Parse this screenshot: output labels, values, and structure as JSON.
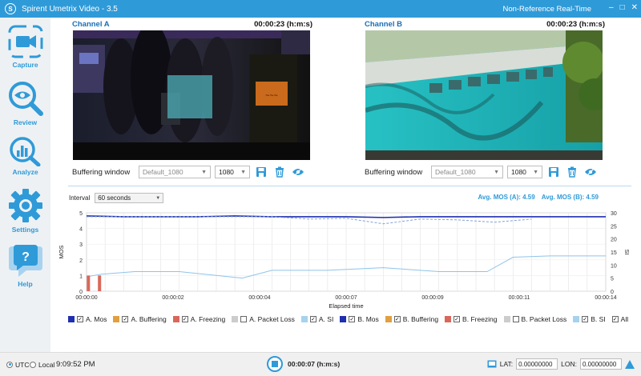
{
  "window": {
    "title": "Spirent Umetrix Video - 3.5",
    "mode": "Non-Reference Real-Time",
    "minimize": "–",
    "maximize": "□",
    "close": "✕"
  },
  "sidebar": {
    "items": [
      {
        "label": "Capture",
        "icon": "camera-icon"
      },
      {
        "label": "Review",
        "icon": "magnifier-icon"
      },
      {
        "label": "Analyze",
        "icon": "analyze-icon"
      },
      {
        "label": "Settings",
        "icon": "gear-icon"
      },
      {
        "label": "Help",
        "icon": "help-icon"
      }
    ]
  },
  "channels": [
    {
      "name": "Channel A",
      "time": "00:00:23 (h:m:s)",
      "buffering_label": "Buffering window",
      "buffering_placeholder": "Default_1080",
      "resolution": "1080"
    },
    {
      "name": "Channel B",
      "time": "00:00:23 (h:m:s)",
      "buffering_label": "Buffering window",
      "buffering_placeholder": "Default_1080",
      "resolution": "1080"
    }
  ],
  "interval": {
    "label": "Interval",
    "value": "60 seconds"
  },
  "averages": {
    "a": "Avg. MOS (A): 4.59",
    "b": "Avg. MOS (B): 4.59"
  },
  "legend": [
    {
      "label": "A. Mos",
      "color": "#1f2fb0",
      "checked": true
    },
    {
      "label": "A. Buffering",
      "color": "#e0a040",
      "checked": true
    },
    {
      "label": "A. Freezing",
      "color": "#d9685a",
      "checked": true
    },
    {
      "label": "A. Packet Loss",
      "color": "#cccccc",
      "checked": false
    },
    {
      "label": "A. SI",
      "color": "#a6d2ef",
      "checked": true
    },
    {
      "label": "B. Mos",
      "color": "#1f2fb0",
      "checked": true
    },
    {
      "label": "B. Buffering",
      "color": "#e0a040",
      "checked": true
    },
    {
      "label": "B. Freezing",
      "color": "#d9685a",
      "checked": true
    },
    {
      "label": "B. Packet Loss",
      "color": "#cccccc",
      "checked": false
    },
    {
      "label": "B. SI",
      "color": "#a6d2ef",
      "checked": true
    },
    {
      "label": "All",
      "color": null,
      "checked": true
    }
  ],
  "chart_data": {
    "type": "line",
    "xlabel": "Elapsed time",
    "ylabel": "MOS",
    "ylabel_right": "SI",
    "x_ticks": [
      "00:00:00",
      "00:00:02",
      "00:00:04",
      "00:00:07",
      "00:00:09",
      "00:00:11",
      "00:00:14"
    ],
    "x_range": [
      0,
      14
    ],
    "ylim": [
      0,
      5
    ],
    "y_ticks": [
      0,
      1,
      2,
      3,
      4,
      5
    ],
    "y2lim": [
      0,
      30
    ],
    "y2_ticks": [
      0,
      5,
      10,
      15,
      20,
      25,
      30
    ],
    "grid": true,
    "series": [
      {
        "name": "A. Mos",
        "axis": "left",
        "style": "solid",
        "color": "#1f2fb0",
        "x": [
          0,
          1,
          2,
          3,
          4,
          5,
          6,
          7,
          8,
          9,
          10,
          11,
          12,
          13,
          14
        ],
        "y": [
          4.8,
          4.75,
          4.75,
          4.75,
          4.8,
          4.75,
          4.75,
          4.75,
          4.7,
          4.75,
          4.75,
          4.75,
          4.75,
          4.75,
          4.75
        ]
      },
      {
        "name": "B. Mos",
        "axis": "left",
        "style": "dashed",
        "color": "#7fa0d8",
        "x": [
          0,
          1,
          2,
          3,
          4,
          5,
          6,
          7,
          8,
          9,
          10,
          11,
          12
        ],
        "y": [
          4.75,
          4.75,
          4.75,
          4.75,
          4.75,
          4.75,
          4.6,
          4.65,
          4.3,
          4.6,
          4.55,
          4.4,
          4.6
        ]
      },
      {
        "name": "A. SI",
        "axis": "right",
        "style": "solid",
        "color": "#8fc4e8",
        "x": [
          0,
          0.4,
          1.3,
          2.5,
          4.2,
          5.0,
          6.5,
          8.0,
          9.5,
          10.8,
          11.5,
          12.5,
          14
        ],
        "y": [
          5.5,
          6.5,
          7.5,
          7.5,
          5.0,
          8.0,
          8.0,
          9.0,
          7.5,
          7.5,
          13.0,
          13.5,
          13.5
        ]
      },
      {
        "name": "A. Freezing",
        "axis": "left",
        "type": "bar",
        "color": "#d9685a",
        "x": [
          0.05,
          0.35
        ],
        "y": [
          1,
          1
        ]
      }
    ]
  },
  "status": {
    "utc": "UTC",
    "local": "Local",
    "clock": "9:09:52 PM",
    "elapsed": "00:00:07 (h:m:s)",
    "lat_label": "LAT:",
    "lat": "0.00000000",
    "lon_label": "LON:",
    "lon": "0.00000000"
  }
}
